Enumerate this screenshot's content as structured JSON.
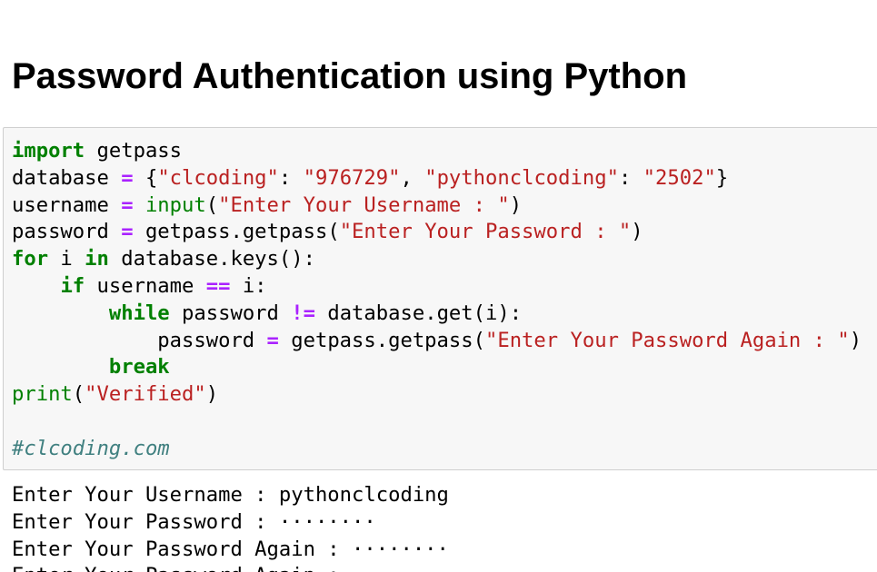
{
  "page": {
    "title": "Password Authentication using Python"
  },
  "code_cell": {
    "lines": [
      [
        {
          "t": "import",
          "c": "kw"
        },
        {
          "t": " getpass",
          "c": "pl"
        }
      ],
      [
        {
          "t": "database ",
          "c": "pl"
        },
        {
          "t": "=",
          "c": "op"
        },
        {
          "t": " {",
          "c": "pl"
        },
        {
          "t": "\"clcoding\"",
          "c": "str"
        },
        {
          "t": ": ",
          "c": "pl"
        },
        {
          "t": "\"976729\"",
          "c": "str"
        },
        {
          "t": ", ",
          "c": "pl"
        },
        {
          "t": "\"pythonclcoding\"",
          "c": "str"
        },
        {
          "t": ": ",
          "c": "pl"
        },
        {
          "t": "\"2502\"",
          "c": "str"
        },
        {
          "t": "}",
          "c": "pl"
        }
      ],
      [
        {
          "t": "username ",
          "c": "pl"
        },
        {
          "t": "=",
          "c": "op"
        },
        {
          "t": " ",
          "c": "pl"
        },
        {
          "t": "input",
          "c": "bi"
        },
        {
          "t": "(",
          "c": "pl"
        },
        {
          "t": "\"Enter Your Username : \"",
          "c": "str"
        },
        {
          "t": ")",
          "c": "pl"
        }
      ],
      [
        {
          "t": "password ",
          "c": "pl"
        },
        {
          "t": "=",
          "c": "op"
        },
        {
          "t": " getpass.getpass(",
          "c": "pl"
        },
        {
          "t": "\"Enter Your Password : \"",
          "c": "str"
        },
        {
          "t": ")",
          "c": "pl"
        }
      ],
      [
        {
          "t": "for",
          "c": "kw"
        },
        {
          "t": " i ",
          "c": "pl"
        },
        {
          "t": "in",
          "c": "kw"
        },
        {
          "t": " database.keys():",
          "c": "pl"
        }
      ],
      [
        {
          "t": "    ",
          "c": "pl"
        },
        {
          "t": "if",
          "c": "kw"
        },
        {
          "t": " username ",
          "c": "pl"
        },
        {
          "t": "==",
          "c": "op"
        },
        {
          "t": " i:",
          "c": "pl"
        }
      ],
      [
        {
          "t": "        ",
          "c": "pl"
        },
        {
          "t": "while",
          "c": "kw"
        },
        {
          "t": " password ",
          "c": "pl"
        },
        {
          "t": "!=",
          "c": "op"
        },
        {
          "t": " database.get(i):",
          "c": "pl"
        }
      ],
      [
        {
          "t": "            password ",
          "c": "pl"
        },
        {
          "t": "=",
          "c": "op"
        },
        {
          "t": " getpass.getpass(",
          "c": "pl"
        },
        {
          "t": "\"Enter Your Password Again : \"",
          "c": "str"
        },
        {
          "t": ")",
          "c": "pl"
        }
      ],
      [
        {
          "t": "        ",
          "c": "pl"
        },
        {
          "t": "break",
          "c": "kw"
        }
      ],
      [
        {
          "t": "print",
          "c": "bi"
        },
        {
          "t": "(",
          "c": "pl"
        },
        {
          "t": "\"Verified\"",
          "c": "str"
        },
        {
          "t": ")",
          "c": "pl"
        }
      ],
      [],
      [
        {
          "t": "#clcoding.com",
          "c": "cm"
        }
      ]
    ]
  },
  "output": {
    "lines": [
      "Enter Your Username : pythonclcoding",
      "Enter Your Password : ········",
      "Enter Your Password Again : ········",
      "Enter Your Password Again : "
    ]
  },
  "colors": {
    "keyword": "#008000",
    "operator": "#aa22ff",
    "builtin": "#008000",
    "string": "#ba2121",
    "comment": "#408080",
    "cell_background": "#f7f7f7",
    "cell_border": "#cfcfcf"
  }
}
